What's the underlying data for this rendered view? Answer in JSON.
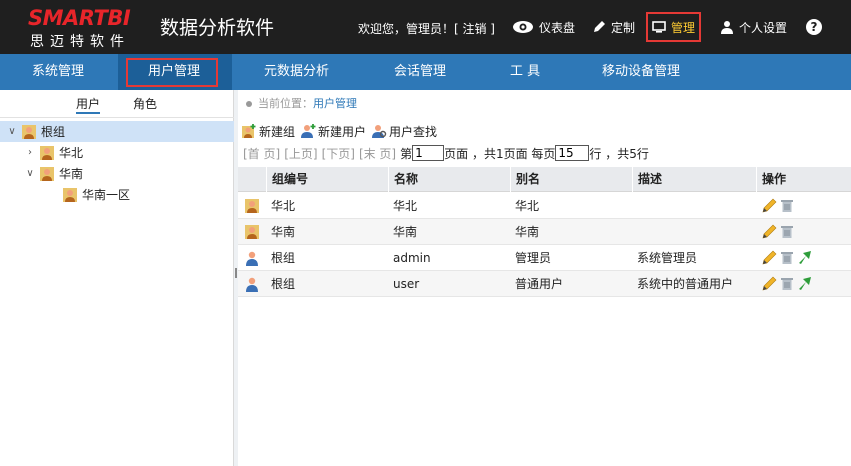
{
  "header": {
    "logo_main": "SMARTBI",
    "logo_sub": "思迈特软件",
    "app_title": "数据分析软件",
    "welcome": "欢迎您，管理员！[ 注销 ]",
    "dashboard": "仪表盘",
    "customize": "定制",
    "manage": "管理",
    "personal": "个人设置",
    "help": "?"
  },
  "nav": {
    "items": [
      "系统管理",
      "用户管理",
      "元数据分析",
      "会话管理",
      "工 具",
      "移动设备管理"
    ]
  },
  "left": {
    "tabs": [
      "用户",
      "角色"
    ],
    "tree": [
      {
        "label": "根组",
        "arrow": "v"
      },
      {
        "label": "华北",
        "arrow": ">"
      },
      {
        "label": "华南",
        "arrow": "v"
      },
      {
        "label": "华南一区",
        "arrow": ""
      }
    ]
  },
  "right": {
    "breadcrumb_prefix": "当前位置：",
    "breadcrumb_current": "用户管理",
    "toolbar": {
      "new_group": "新建组",
      "new_user": "新建用户",
      "find_user": "用户查找"
    },
    "pager": {
      "first": "[首 页]",
      "prev": "[上页]",
      "next": "[下页]",
      "last": "[末 页]",
      "page_label": "第",
      "page_value": "1",
      "page_suffix": "页面 ，共1页面 每页",
      "per_page_value": "15",
      "total": "行 ，共5行"
    },
    "columns": [
      "组编号",
      "名称",
      "别名",
      "描述",
      "操作"
    ],
    "rows": [
      {
        "type": "group",
        "group": "华北",
        "name": "华北",
        "alias": "华北",
        "desc": ""
      },
      {
        "type": "group",
        "group": "华南",
        "name": "华南",
        "alias": "华南",
        "desc": ""
      },
      {
        "type": "user",
        "group": "根组",
        "name": "admin",
        "alias": "管理员",
        "desc": "系统管理员"
      },
      {
        "type": "user",
        "group": "根组",
        "name": "user",
        "alias": "普通用户",
        "desc": "系统中的普通用户"
      }
    ]
  },
  "colors": {
    "header_bg": "#1f1f1f",
    "nav_bg": "#2e78b7",
    "highlight_box": "#e53935",
    "logo_red": "#e8252a"
  }
}
